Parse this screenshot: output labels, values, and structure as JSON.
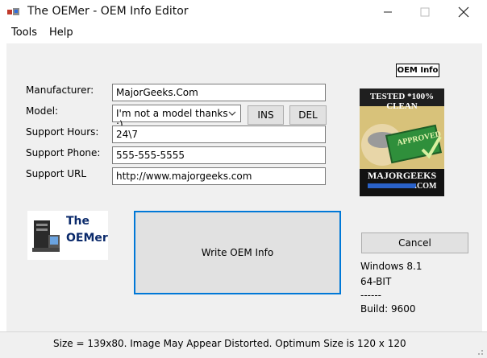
{
  "window": {
    "title": "The OEMer - OEM Info Editor"
  },
  "menu": [
    "Tools",
    "Help"
  ],
  "form": {
    "manufacturer_label": "Manufacturer:",
    "manufacturer_value": "MajorGeeks.Com",
    "model_label": "Model:",
    "model_value": "I'm not a model thanks :)",
    "ins_label": "INS",
    "del_label": "DEL",
    "support_hours_label": "Support Hours:",
    "support_hours_value": "24\\7",
    "support_phone_label": "Support Phone:",
    "support_phone_value": "555-555-5555",
    "support_url_label": "Support URL",
    "support_url_value": "http://www.majorgeeks.com"
  },
  "logo_panel": {
    "oem_badge": "OEM Info",
    "logo_line1": "The",
    "logo_line2": "OEMer"
  },
  "seal": {
    "top": "TESTED *100% CLEAN",
    "middle": "APPROVED",
    "bottom": "MAJORGEEKS",
    "com": ".COM"
  },
  "actions": {
    "write_label": "Write OEM Info",
    "cancel_label": "Cancel"
  },
  "sysinfo": {
    "os": "Windows 8.1",
    "arch": "64-BIT",
    "sep": "------",
    "build": "Build: 9600"
  },
  "status": "Size = 139x80. Image May Appear Distorted. Optimum Size is 120 x 120",
  "colors": {
    "client_bg": "#f0f0f0",
    "focus_blue": "#0078d7",
    "button_bg": "#e1e1e1"
  }
}
